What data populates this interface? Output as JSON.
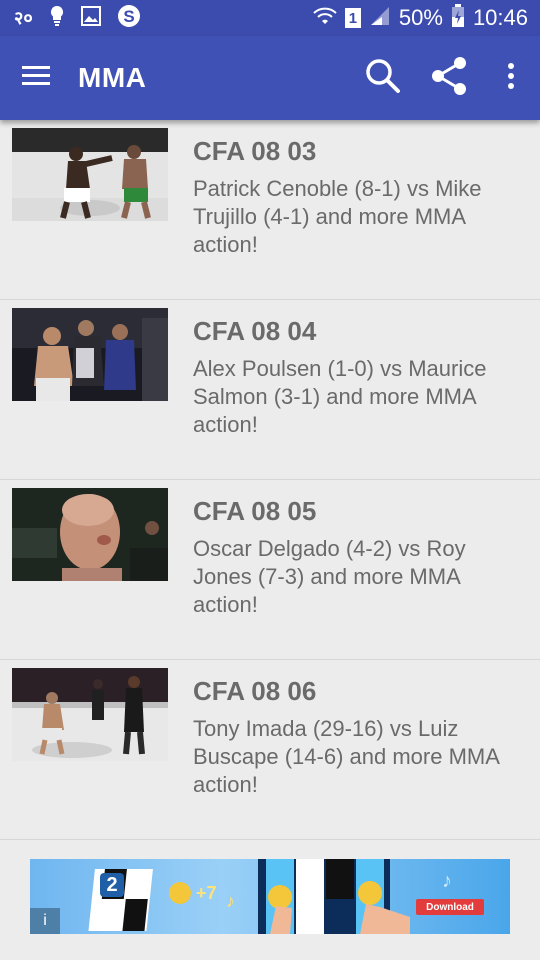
{
  "status_bar": {
    "left_text": "२०",
    "sim": "1",
    "battery_percent": "50%",
    "time": "10:46",
    "icons": [
      "notification-text",
      "lightbulb-icon",
      "image-icon",
      "skype-icon",
      "wifi-icon",
      "sim-icon",
      "signal-icon",
      "battery-charging-icon"
    ]
  },
  "app_bar": {
    "title": "MMA",
    "color": "#3f51b5",
    "status_color": "#3c4cae",
    "icons": [
      "menu-icon",
      "search-icon",
      "share-icon",
      "more-vert-icon"
    ]
  },
  "items": [
    {
      "title": "CFA 08 03",
      "desc": "Patrick Cenoble (8-1) vs Mike Trujillo (4-1) and more MMA action!"
    },
    {
      "title": "CFA 08 04",
      "desc": "Alex Poulsen (1-0) vs Maurice Salmon (3-1) and more MMA action!"
    },
    {
      "title": "CFA 08 05",
      "desc": "Oscar Delgado (4-2) vs Roy Jones (7-3) and more MMA action!"
    },
    {
      "title": "CFA 08 06",
      "desc": "Tony Imada (29-16) vs Luiz Buscape (14-6) and more MMA action!"
    }
  ],
  "ad": {
    "number": "2",
    "bonus": "+7",
    "download_label": "Download",
    "info": "i"
  }
}
